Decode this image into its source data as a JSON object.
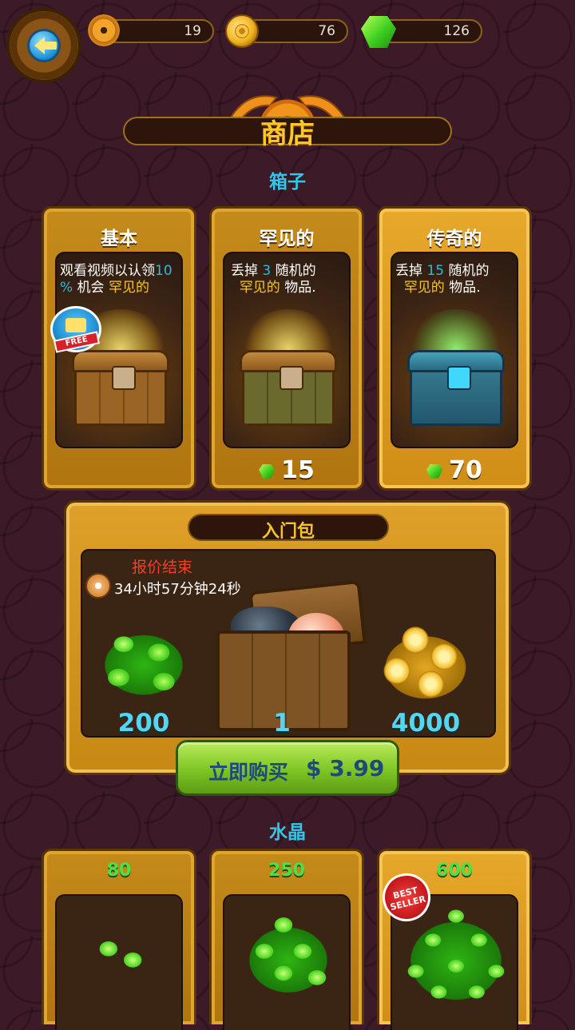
{
  "resources": {
    "gears": "19",
    "coins": "76",
    "crystals": "126"
  },
  "title": "商店",
  "boxes_section": "箱子",
  "chests": [
    {
      "name": "基本",
      "desc_line1": "观看视频以认领",
      "desc_num": "10",
      "desc_pct": "%",
      "desc_mid": " 机会 ",
      "desc_hl": "罕见的",
      "badge": "FREE"
    },
    {
      "name": "罕见的",
      "desc_pre": "丢掉 ",
      "desc_num": "3",
      "desc_post": " 随机的",
      "desc_hl": "罕见的",
      "desc_end": " 物品.",
      "price": "15"
    },
    {
      "name": "传奇的",
      "desc_pre": "丢掉 ",
      "desc_num": "15",
      "desc_post": " 随机的",
      "desc_hl": "罕见的",
      "desc_end": " 物品.",
      "price": "70"
    }
  ],
  "starter_pack": {
    "title": "入门包",
    "offer_end": "报价结束",
    "timer": "34小时57分钟24秒",
    "crystals": "200",
    "chest": "1",
    "coins": "4000",
    "buy_label": "立即购买",
    "buy_price": "$ 3.99"
  },
  "crystals_section": "水晶",
  "crystal_packs": [
    {
      "amount": "80"
    },
    {
      "amount": "250"
    },
    {
      "amount": "600",
      "badge_line1": "BEST",
      "badge_line2": "SELLER"
    }
  ],
  "colors": {
    "accent_cyan": "#33c6e8",
    "gold_text": "#ffc924",
    "crystal_green": "#4ee04a",
    "offer_red": "#ff3b2a"
  },
  "icons": [
    "back-arrow-icon",
    "gear-icon",
    "coin-icon",
    "crystal-icon",
    "video-camera-icon",
    "timer-icon"
  ]
}
